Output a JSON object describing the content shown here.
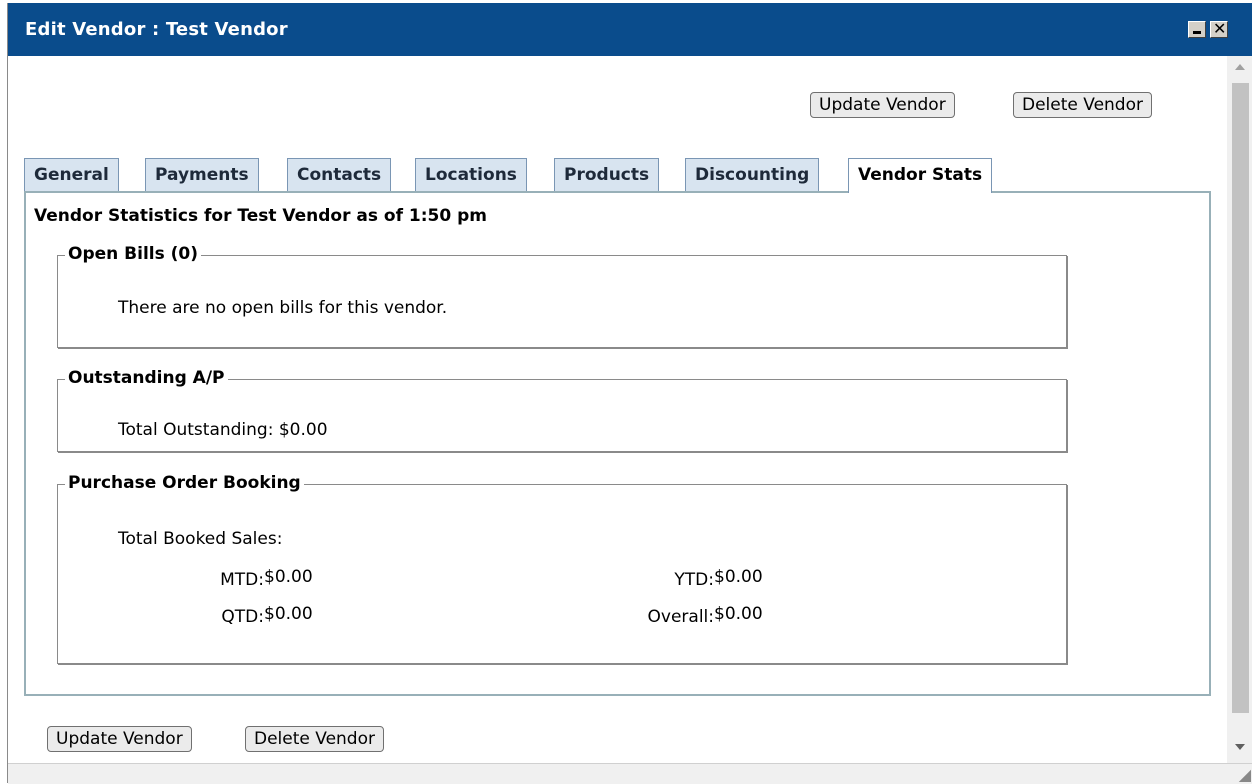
{
  "window": {
    "title": "Edit Vendor : Test Vendor"
  },
  "toolbar": {
    "update_label": "Update Vendor",
    "delete_label": "Delete Vendor"
  },
  "tabs": [
    {
      "label": "General"
    },
    {
      "label": "Payments"
    },
    {
      "label": "Contacts"
    },
    {
      "label": "Locations"
    },
    {
      "label": "Products"
    },
    {
      "label": "Discounting"
    },
    {
      "label": "Vendor Stats",
      "active": true
    }
  ],
  "stats": {
    "heading": "Vendor Statistics for Test Vendor as of 1:50 pm",
    "open_bills": {
      "legend": "Open Bills (0)",
      "message": "There are no open bills for this vendor."
    },
    "outstanding": {
      "legend": "Outstanding A/P",
      "text": "Total Outstanding: $0.00"
    },
    "booking": {
      "legend": "Purchase Order Booking",
      "subtitle": "Total Booked Sales:",
      "mtd_label": "MTD:",
      "mtd_value": "$0.00",
      "qtd_label": "QTD:",
      "qtd_value": "$0.00",
      "ytd_label": "YTD:",
      "ytd_value": "$0.00",
      "overall_label": "Overall:",
      "overall_value": "$0.00"
    }
  },
  "icons": {
    "minimize": "minimize-icon",
    "close": "close-icon",
    "resize": "resize-grip-icon"
  },
  "colors": {
    "titlebar": "#0a4c8c",
    "tab_inactive": "#d8e4f0",
    "panel_border": "#98b0b8"
  }
}
